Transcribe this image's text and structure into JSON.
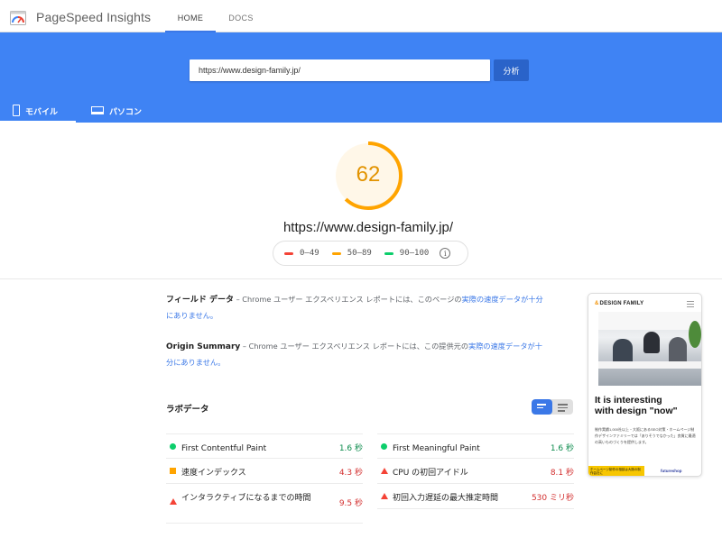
{
  "app": {
    "title": "PageSpeed Insights",
    "nav_tabs": [
      {
        "label": "HOME",
        "active": true
      },
      {
        "label": "DOCS",
        "active": false
      }
    ]
  },
  "search": {
    "url_value": "https://www.design-family.jp/",
    "analyze_label": "分析"
  },
  "device_tabs": [
    {
      "label": "モバイル",
      "icon": "phone-icon",
      "active": true
    },
    {
      "label": "パソコン",
      "icon": "laptop-icon",
      "active": false
    }
  ],
  "report": {
    "score": "62",
    "score_fraction": 0.62,
    "score_color": "#e29300",
    "url": "https://www.design-family.jp/",
    "legend": [
      {
        "range": "0–49",
        "color": "#f44336"
      },
      {
        "range": "50–89",
        "color": "#ffa400"
      },
      {
        "range": "90–100",
        "color": "#0cce6b"
      }
    ],
    "legend_info_icon": "info-icon"
  },
  "field_data": {
    "title": "フィールド データ",
    "dash": "–",
    "text": "Chrome ユーザー エクスペリエンス レポートには、このページの",
    "link": "実際の速度データが十分にありません。"
  },
  "origin_summary": {
    "title": "Origin Summary",
    "dash": "–",
    "text": "Chrome ユーザー エクスペリエンス レポートには、この提供元の",
    "link": "実際の速度データが十分にありません。"
  },
  "lab_data": {
    "title": "ラボデータ",
    "metrics_left": [
      {
        "name": "First Contentful Paint",
        "value": "1.6 秒",
        "status": "good"
      },
      {
        "name": "速度インデックス",
        "value": "4.3 秒",
        "status": "poor_square"
      },
      {
        "name": "インタラクティブになるまでの時間",
        "value": "9.5 秒",
        "status": "poor"
      }
    ],
    "metrics_right": [
      {
        "name": "First Meaningful Paint",
        "value": "1.6 秒",
        "status": "good"
      },
      {
        "name": "CPU の初回アイドル",
        "value": "8.1 秒",
        "status": "poor"
      },
      {
        "name": "初回入力遅延の最大推定時間",
        "value": "530 ミリ秒",
        "status": "poor"
      }
    ]
  },
  "screenshot": {
    "brand": "DESIGN FAMILY",
    "hero_line1": "It is interesting",
    "hero_line2": "with design \"now\"",
    "desc": "制作実績1,000社以上・大阪にあるSEO対策・ホームページ制作デザインファミリーでは「ありそうでなかった」良質に最適の高いものづくりを提供します。",
    "banner": "ホームページ制作の相談は大阪の制作会社に",
    "partner": "futureshop"
  }
}
